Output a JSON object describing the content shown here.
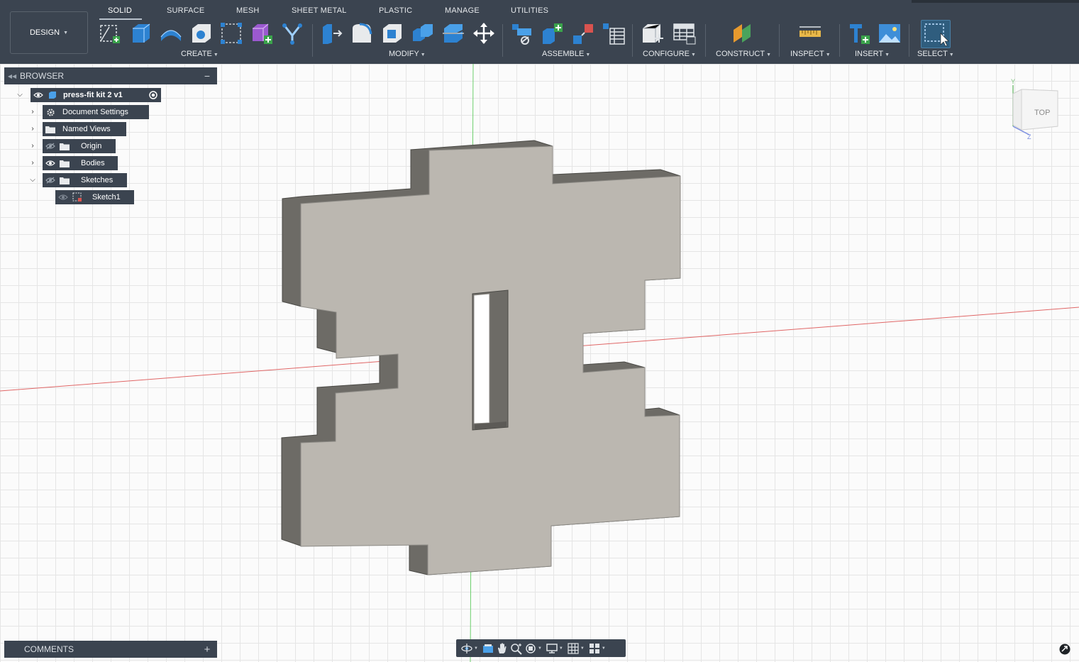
{
  "workspace": {
    "label": "DESIGN"
  },
  "tabs": [
    {
      "label": "SOLID",
      "active": true
    },
    {
      "label": "SURFACE"
    },
    {
      "label": "MESH"
    },
    {
      "label": "SHEET METAL"
    },
    {
      "label": "PLASTIC"
    },
    {
      "label": "MANAGE"
    },
    {
      "label": "UTILITIES"
    }
  ],
  "toolbar_groups": {
    "create": "CREATE",
    "modify": "MODIFY",
    "assemble": "ASSEMBLE",
    "configure": "CONFIGURE",
    "construct": "CONSTRUCT",
    "inspect": "INSPECT",
    "insert": "INSERT",
    "select": "SELECT"
  },
  "browser": {
    "title": "BROWSER",
    "root": "press-fit kit 2 v1",
    "items": [
      {
        "label": "Document Settings",
        "icon": "gear-icon"
      },
      {
        "label": "Named Views",
        "icon": "folder-icon"
      },
      {
        "label": "Origin",
        "icon": "folder-icon",
        "visibility": "hidden"
      },
      {
        "label": "Bodies",
        "icon": "folder-icon",
        "visibility": "visible"
      },
      {
        "label": "Sketches",
        "icon": "folder-icon",
        "visibility": "hidden",
        "expanded": true
      },
      {
        "label": "Sketch1",
        "icon": "sketch-icon",
        "visibility": "hidden",
        "child_of": "Sketches"
      }
    ]
  },
  "comments": {
    "title": "COMMENTS"
  },
  "viewcube": {
    "face": "TOP",
    "axis_y": "Y",
    "axis_z": "Z"
  },
  "colors": {
    "toolbar_bg": "#3b4450",
    "body_top": "#bbb7b0",
    "body_side": "#6d6b66",
    "grid": "#e5e5e5",
    "axis_x": "#e06666",
    "axis_y": "#6ccf6c",
    "select_active": "#2f5d7e"
  }
}
